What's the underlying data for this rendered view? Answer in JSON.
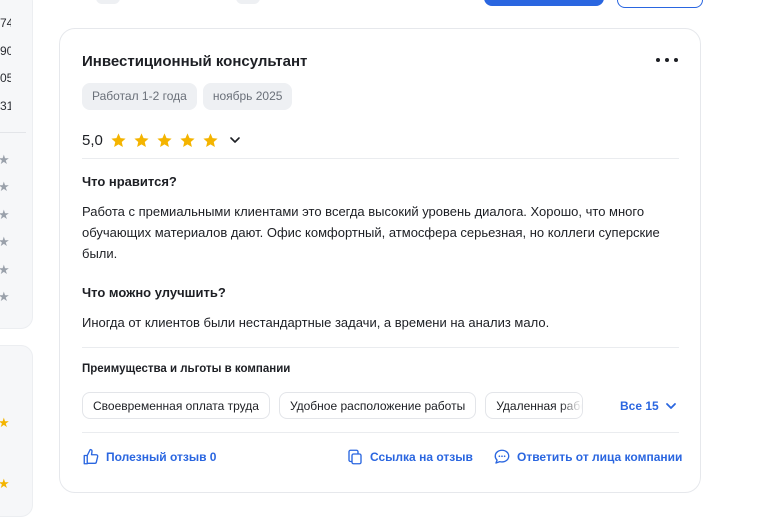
{
  "left_column": {
    "numbers": [
      "74",
      "90",
      "05",
      "31"
    ]
  },
  "review": {
    "title": "Инвестиционный консультант",
    "tags": [
      "Работал 1-2 года",
      "ноябрь 2025"
    ],
    "rating": "5,0",
    "stars": 5,
    "pros_label": "Что нравится?",
    "pros_text": "Работа с премиальными клиентами это всегда высокий уровень диалога. Хорошо, что много обучающих материалов дают. Офис комфортный, атмосфера серьезная, но коллеги суперские были.",
    "cons_label": "Что можно улучшить?",
    "cons_text": "Иногда от клиентов были нестандартные задачи, а времени на анализ мало.",
    "benefits_title": "Преимущества и льготы в компании",
    "benefits": [
      "Своевременная оплата труда",
      "Удобное расположение работы",
      "Удаленная работа"
    ],
    "all_benefits": "Все 15",
    "actions": {
      "useful": "Полезный отзыв 0",
      "link": "Ссылка на отзыв",
      "reply": "Ответить от лица компании"
    }
  },
  "colors": {
    "accent": "#2a66e0",
    "star": "#f4b400",
    "chip_bg": "#eef0f3"
  }
}
